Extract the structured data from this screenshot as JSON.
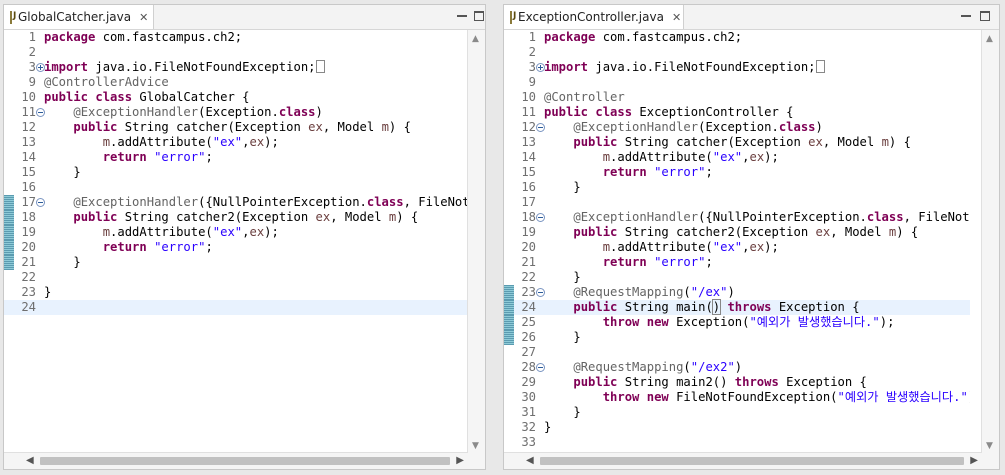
{
  "editors": [
    {
      "tab_title": "GlobalCatcher.java",
      "current_line": 24,
      "lines": [
        {
          "n": "1",
          "fold": "",
          "mark": false,
          "html": "<span class=\"k\">package</span> com.fastcampus.ch2;"
        },
        {
          "n": "2",
          "fold": "",
          "mark": false,
          "html": ""
        },
        {
          "n": "3",
          "fold": "expand",
          "mark": false,
          "html": "<span class=\"k\">import</span> java.io.FileNotFoundException;<span style=\"display:inline-block;width:7px;height:11px;border:1px solid #888;vertical-align:-2px;\"></span>"
        },
        {
          "n": "9",
          "fold": "",
          "mark": false,
          "html": "<span class=\"a\">@ControllerAdvice</span>"
        },
        {
          "n": "10",
          "fold": "",
          "mark": false,
          "html": "<span class=\"k\">public</span> <span class=\"k\">class</span> GlobalCatcher {"
        },
        {
          "n": "11",
          "fold": "collapse",
          "mark": false,
          "html": "    <span class=\"a\">@ExceptionHandler</span>(Exception.<span class=\"k\">class</span>)"
        },
        {
          "n": "12",
          "fold": "",
          "mark": false,
          "html": "    <span class=\"k\">public</span> String catcher(Exception <span class=\"f\">ex</span>, Model <span class=\"f\">m</span>) {"
        },
        {
          "n": "13",
          "fold": "",
          "mark": false,
          "html": "        <span class=\"f\">m</span>.addAttribute(<span class=\"s\">\"ex\"</span>,<span class=\"f\">ex</span>);"
        },
        {
          "n": "14",
          "fold": "",
          "mark": false,
          "html": "        <span class=\"k\">return</span> <span class=\"s\">\"error\"</span>;"
        },
        {
          "n": "15",
          "fold": "",
          "mark": false,
          "html": "    }"
        },
        {
          "n": "16",
          "fold": "",
          "mark": false,
          "html": ""
        },
        {
          "n": "17",
          "fold": "collapse",
          "mark": true,
          "html": "    <span class=\"a\">@ExceptionHandler</span>({NullPointerException.<span class=\"k\">class</span>, FileNotFoundException.<span class=\"k\">class</span>})"
        },
        {
          "n": "18",
          "fold": "",
          "mark": true,
          "html": "    <span class=\"k\">public</span> String catcher2(Exception <span class=\"f\">ex</span>, Model <span class=\"f\">m</span>) {"
        },
        {
          "n": "19",
          "fold": "",
          "mark": true,
          "html": "        <span class=\"f\">m</span>.addAttribute(<span class=\"s\">\"ex\"</span>,<span class=\"f\">ex</span>);"
        },
        {
          "n": "20",
          "fold": "",
          "mark": true,
          "html": "        <span class=\"k\">return</span> <span class=\"s\">\"error\"</span>;"
        },
        {
          "n": "21",
          "fold": "",
          "mark": true,
          "html": "    }"
        },
        {
          "n": "22",
          "fold": "",
          "mark": false,
          "html": ""
        },
        {
          "n": "23",
          "fold": "",
          "mark": false,
          "html": "}"
        },
        {
          "n": "24",
          "fold": "",
          "mark": false,
          "html": ""
        }
      ]
    },
    {
      "tab_title": "ExceptionController.java",
      "current_line": 24,
      "lines": [
        {
          "n": "1",
          "fold": "",
          "mark": false,
          "html": "<span class=\"k\">package</span> com.fastcampus.ch2;"
        },
        {
          "n": "2",
          "fold": "",
          "mark": false,
          "html": ""
        },
        {
          "n": "3",
          "fold": "expand",
          "mark": false,
          "html": "<span class=\"k\">import</span> java.io.FileNotFoundException;<span style=\"display:inline-block;width:7px;height:11px;border:1px solid #888;vertical-align:-2px;\"></span>"
        },
        {
          "n": "9",
          "fold": "",
          "mark": false,
          "html": ""
        },
        {
          "n": "10",
          "fold": "",
          "mark": false,
          "html": "<span class=\"a\">@Controller</span>"
        },
        {
          "n": "11",
          "fold": "",
          "mark": false,
          "html": "<span class=\"k\">public</span> <span class=\"k\">class</span> ExceptionController {"
        },
        {
          "n": "12",
          "fold": "collapse",
          "mark": false,
          "html": "    <span class=\"a\">@ExceptionHandler</span>(Exception.<span class=\"k\">class</span>)"
        },
        {
          "n": "13",
          "fold": "",
          "mark": false,
          "html": "    <span class=\"k\">public</span> String catcher(Exception <span class=\"f\">ex</span>, Model <span class=\"f\">m</span>) {"
        },
        {
          "n": "14",
          "fold": "",
          "mark": false,
          "html": "        <span class=\"f\">m</span>.addAttribute(<span class=\"s\">\"ex\"</span>,<span class=\"f\">ex</span>);"
        },
        {
          "n": "15",
          "fold": "",
          "mark": false,
          "html": "        <span class=\"k\">return</span> <span class=\"s\">\"error\"</span>;"
        },
        {
          "n": "16",
          "fold": "",
          "mark": false,
          "html": "    }"
        },
        {
          "n": "17",
          "fold": "",
          "mark": false,
          "html": ""
        },
        {
          "n": "18",
          "fold": "collapse",
          "mark": false,
          "html": "    <span class=\"a\">@ExceptionHandler</span>({NullPointerException.<span class=\"k\">class</span>, FileNotFoundException.<span class=\"k\">class</span>})"
        },
        {
          "n": "19",
          "fold": "",
          "mark": false,
          "html": "    <span class=\"k\">public</span> String catcher2(Exception <span class=\"f\">ex</span>, Model <span class=\"f\">m</span>) {"
        },
        {
          "n": "20",
          "fold": "",
          "mark": false,
          "html": "        <span class=\"f\">m</span>.addAttribute(<span class=\"s\">\"ex\"</span>,<span class=\"f\">ex</span>);"
        },
        {
          "n": "21",
          "fold": "",
          "mark": false,
          "html": "        <span class=\"k\">return</span> <span class=\"s\">\"error\"</span>;"
        },
        {
          "n": "22",
          "fold": "",
          "mark": false,
          "html": "    }"
        },
        {
          "n": "23",
          "fold": "collapse",
          "mark": true,
          "html": "    <span class=\"a\">@RequestMapping</span>(<span class=\"s\">\"/ex\"</span>)"
        },
        {
          "n": "24",
          "fold": "",
          "mark": true,
          "html": "    <span class=\"k\">public</span> String main(<span style=\"outline:1px solid #888;\">)</span> <span class=\"k\">throws</span> Exception {"
        },
        {
          "n": "25",
          "fold": "",
          "mark": true,
          "html": "        <span class=\"k\">throw</span> <span class=\"k\">new</span> Exception(<span class=\"s\">\"예외가 발생했습니다.\"</span>);"
        },
        {
          "n": "26",
          "fold": "",
          "mark": true,
          "html": "    }"
        },
        {
          "n": "27",
          "fold": "",
          "mark": false,
          "html": ""
        },
        {
          "n": "28",
          "fold": "collapse",
          "mark": false,
          "html": "    <span class=\"a\">@RequestMapping</span>(<span class=\"s\">\"/ex2\"</span>)"
        },
        {
          "n": "29",
          "fold": "",
          "mark": false,
          "html": "    <span class=\"k\">public</span> String main2() <span class=\"k\">throws</span> Exception {"
        },
        {
          "n": "30",
          "fold": "",
          "mark": false,
          "html": "        <span class=\"k\">throw</span> <span class=\"k\">new</span> FileNotFoundException(<span class=\"s\">\"예외가 발생했습니다.\"</span>);"
        },
        {
          "n": "31",
          "fold": "",
          "mark": false,
          "html": "    }"
        },
        {
          "n": "32",
          "fold": "",
          "mark": false,
          "html": "}"
        },
        {
          "n": "33",
          "fold": "",
          "mark": false,
          "html": ""
        }
      ]
    }
  ],
  "icons": {
    "file": "java-file-icon",
    "close": "close-icon",
    "minimize": "minimize-icon",
    "maximize": "maximize-icon"
  },
  "colors": {
    "keyword": "#7f0055",
    "string": "#2a00ff",
    "annotation": "#646464",
    "current_line": "#e8f2fe"
  }
}
